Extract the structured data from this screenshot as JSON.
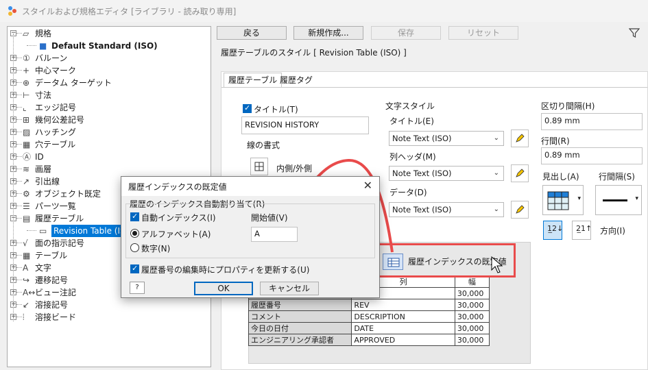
{
  "window": {
    "title": "スタイルおよび規格エディタ [ライブラリ - 読み取り専用]"
  },
  "tree": {
    "items": [
      {
        "label": "規格",
        "icon": "standard-icon",
        "level": 0,
        "expanded": true
      },
      {
        "label": "Default Standard (ISO)",
        "icon": "standard-item-icon",
        "level": 1,
        "bold": true
      },
      {
        "label": "バルーン",
        "icon": "balloon-icon",
        "level": 0
      },
      {
        "label": "中心マーク",
        "icon": "center-mark-icon",
        "level": 0
      },
      {
        "label": "データム ターゲット",
        "icon": "datum-target-icon",
        "level": 0
      },
      {
        "label": "寸法",
        "icon": "dimension-icon",
        "level": 0
      },
      {
        "label": "エッジ記号",
        "icon": "edge-symbol-icon",
        "level": 0
      },
      {
        "label": "幾何公差記号",
        "icon": "feature-control-frame-icon",
        "level": 0
      },
      {
        "label": "ハッチング",
        "icon": "hatch-icon",
        "level": 0
      },
      {
        "label": "穴テーブル",
        "icon": "hole-table-icon",
        "level": 0
      },
      {
        "label": "ID",
        "icon": "id-icon",
        "level": 0
      },
      {
        "label": "画層",
        "icon": "layer-icon",
        "level": 0
      },
      {
        "label": "引出線",
        "icon": "leader-icon",
        "level": 0
      },
      {
        "label": "オブジェクト既定",
        "icon": "object-defaults-icon",
        "level": 0
      },
      {
        "label": "パーツ一覧",
        "icon": "parts-list-icon",
        "level": 0
      },
      {
        "label": "履歴テーブル",
        "icon": "revision-table-icon",
        "level": 0,
        "expanded": true
      },
      {
        "label": "Revision Table (ISO)",
        "icon": "revision-table-item-icon",
        "level": 1,
        "selected": true
      },
      {
        "label": "面の指示記号",
        "icon": "surface-texture-icon",
        "level": 0
      },
      {
        "label": "テーブル",
        "icon": "table-icon",
        "level": 0
      },
      {
        "label": "文字",
        "icon": "text-icon",
        "level": 0
      },
      {
        "label": "遷移記号",
        "icon": "taper-symbol-icon",
        "level": 0
      },
      {
        "label": "ビュー注記",
        "icon": "view-annotation-icon",
        "level": 0
      },
      {
        "label": "溶接記号",
        "icon": "weld-symbol-icon",
        "level": 0
      },
      {
        "label": "溶接ビード",
        "icon": "weld-bead-icon",
        "level": 0
      }
    ]
  },
  "toolbar": {
    "back": "戻る",
    "new": "新規作成...",
    "save": "保存",
    "reset": "リセット"
  },
  "panel": {
    "title": "履歴テーブルのスタイル [ Revision Table (ISO) ]",
    "tabs": [
      "履歴テーブル",
      "履歴タグ"
    ],
    "title_check": "タイトル(T)",
    "title_value": "REVISION HISTORY",
    "line_format": "線の書式",
    "line_option": "内側/外側",
    "text_style": "文字スタイル",
    "title_label": "タイトル(E)",
    "title_style": "Note Text (ISO)",
    "col_header_label": "列ヘッダ(M)",
    "col_header_style": "Note Text (ISO)",
    "data_label": "データ(D)",
    "data_style": "Note Text (ISO)",
    "spacing_label": "区切り間隔(H)",
    "spacing_value": "0.89 mm",
    "row_label": "行間(R)",
    "row_value": "0.89 mm",
    "heading_label": "見出し(A)",
    "row_gap_label": "行間隔(S)",
    "direction_label": "方向(I)",
    "index_button": "履歴インデックスの既定値"
  },
  "preview": {
    "headers": [
      "列",
      "幅"
    ],
    "rows": [
      {
        "name": "",
        "col": "",
        "width": "30,000"
      },
      {
        "name": "履歴番号",
        "col": "REV",
        "width": "30,000"
      },
      {
        "name": "コメント",
        "col": "DESCRIPTION",
        "width": "30,000"
      },
      {
        "name": "今日の日付",
        "col": "DATE",
        "width": "30,000"
      },
      {
        "name": "エンジニアリング承認者",
        "col": "APPROVED",
        "width": "30,000"
      }
    ]
  },
  "dialog": {
    "title": "履歴インデックスの既定値",
    "group_label": "履歴のインデックス自動割り当て(R)",
    "auto_index": "自動インデックス(I)",
    "start_label": "開始値(V)",
    "start_value": "A",
    "alpha": "アルファベット(A)",
    "numeric": "数字(N)",
    "update_props": "履歴番号の編集時にプロパティを更新する(U)",
    "ok": "OK",
    "cancel": "キャンセル"
  },
  "colors": {
    "accent": "#0078d7",
    "highlight": "#e94b4b"
  }
}
